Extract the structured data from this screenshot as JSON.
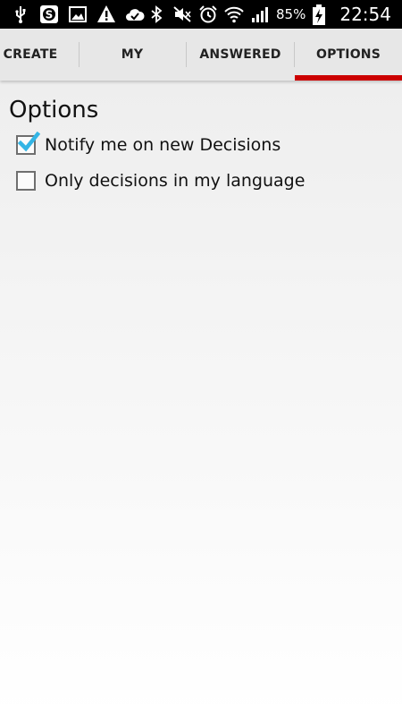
{
  "status_bar": {
    "left_icons": [
      "usb-icon",
      "s-app-icon",
      "image-icon",
      "warning-icon",
      "cloud-check-icon"
    ],
    "right_icons": [
      "bluetooth-icon",
      "mute-icon",
      "alarm-icon",
      "wifi-icon",
      "signal-icon",
      "battery-charging-icon"
    ],
    "battery_percent": "85%",
    "time": "22:54"
  },
  "tabs": [
    {
      "label": "CREATE",
      "selected": false
    },
    {
      "label": "MY",
      "selected": false
    },
    {
      "label": "ANSWERED",
      "selected": false
    },
    {
      "label": "OPTIONS",
      "selected": true
    }
  ],
  "accent_color": "#cc0000",
  "check_color": "#33b5e5",
  "page_title": "Options",
  "options": [
    {
      "label": "Notify me on new Decisions",
      "checked": true
    },
    {
      "label": "Only decisions in my language",
      "checked": false
    }
  ]
}
